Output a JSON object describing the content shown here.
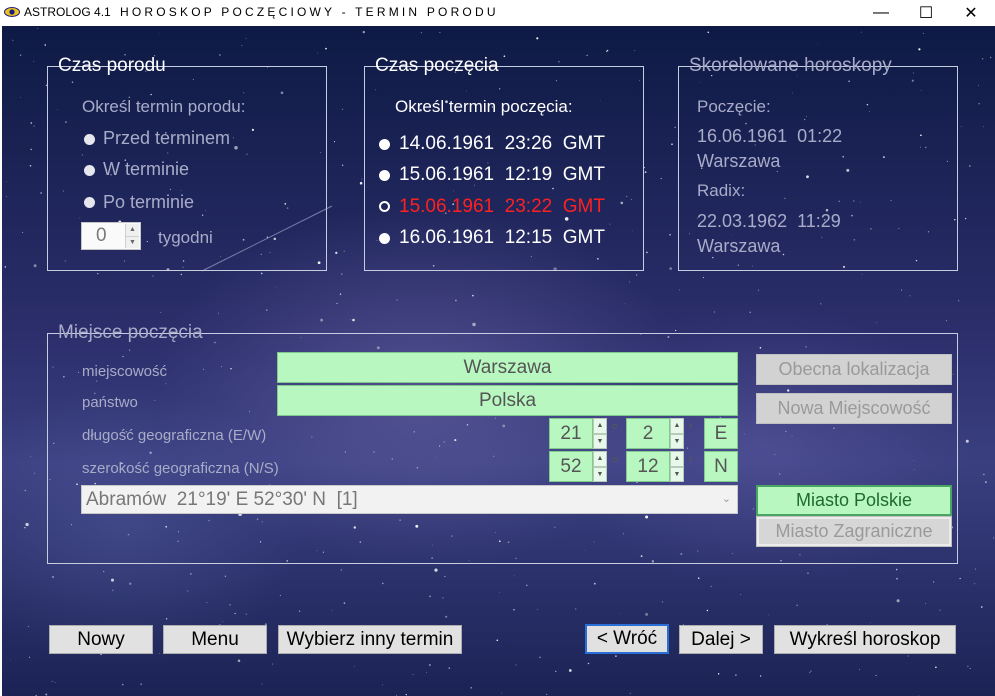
{
  "window": {
    "app_name": "ASTROLOG 4.1",
    "title": "HOROSKOP POCZĘCIOWY  -  TERMIN PORODU",
    "minimize": "—",
    "maximize": "☐",
    "close": "✕"
  },
  "birth_time": {
    "legend": "Czas porodu",
    "prompt": "Określ termin porodu:",
    "options": [
      "Przed terminem",
      "W terminie",
      "Po terminie"
    ],
    "weeks_value": "0",
    "weeks_label": "tygodni"
  },
  "conception_time": {
    "legend": "Czas poczęcia",
    "prompt": "Określ termin poczęcia:",
    "options": [
      {
        "date": "14.06.1961",
        "time": "23:26",
        "zone": "GMT"
      },
      {
        "date": "15.06.1961",
        "time": "12:19",
        "zone": "GMT"
      },
      {
        "date": "15.06.1961",
        "time": "23:22",
        "zone": "GMT"
      },
      {
        "date": "16.06.1961",
        "time": "12:15",
        "zone": "GMT"
      }
    ],
    "selected_index": 2
  },
  "correlated": {
    "legend": "Skorelowane horoskopy",
    "conception_label": "Poczęcie:",
    "conception_datetime": "16.06.1961  01:22",
    "conception_city": "Warszawa",
    "radix_label": "Radix:",
    "radix_datetime": "22.03.1962  11:29",
    "radix_city": "Warszawa"
  },
  "place": {
    "legend": "Miejsce poczęcia",
    "city_label": "miejscowość",
    "city_value": "Warszawa",
    "country_label": "państwo",
    "country_value": "Polska",
    "longitude_label": "długość geograficzna (E/W)",
    "longitude_deg": "21",
    "longitude_min": "2",
    "longitude_dir": "E",
    "latitude_label": "szerokość geograficzna (N/S)",
    "latitude_deg": "52",
    "latitude_min": "12",
    "latitude_dir": "N",
    "deg_symbol": "°",
    "min_symbol": "'",
    "combo_value": "Abramów  21°19' E 52°30' N  [1]",
    "btn_current_location": "Obecna lokalizacja",
    "btn_new_city": "Nowa Miejscowość",
    "btn_polish_city": "Miasto Polskie",
    "btn_foreign_city": "Miasto Zagraniczne"
  },
  "footer": {
    "btn_new": "Nowy",
    "btn_menu": "Menu",
    "btn_choose_term": "Wybierz inny termin",
    "btn_back": "< Wróć",
    "btn_next": "Dalej >",
    "btn_draw": "Wykreśl horoskop"
  },
  "colors": {
    "selected_option": "#ff2020",
    "green_field": "#b8f7c0",
    "background": "#1b2355"
  }
}
